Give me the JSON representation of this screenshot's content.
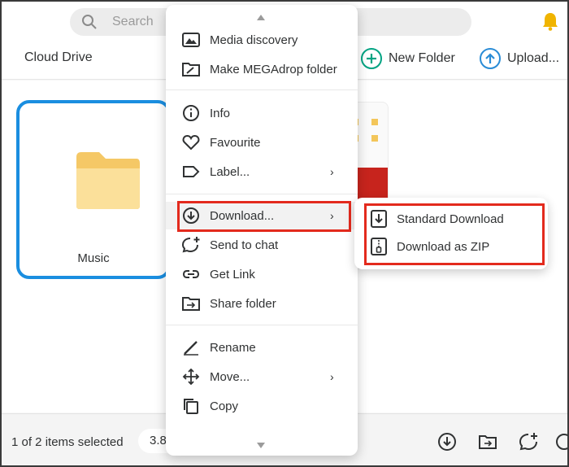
{
  "topbar": {
    "search_placeholder": "Search",
    "breadcrumb": "Cloud Drive",
    "new_folder_label": "New Folder",
    "upload_label": "Upload...",
    "accent_green": "#00a382",
    "accent_blue": "#2a8cd6",
    "bell_color": "#f0b400"
  },
  "main": {
    "folder_name": "Music",
    "selection_color": "#1a8ee0"
  },
  "bottombar": {
    "selection_text": "1 of 2 items selected",
    "size_text": "3.8"
  },
  "context_menu": {
    "items": [
      {
        "label": "Media discovery",
        "icon": "media-discovery-icon"
      },
      {
        "label": "Make MEGAdrop folder",
        "icon": "megadrop-icon"
      },
      {
        "label": "Info",
        "icon": "info-icon"
      },
      {
        "label": "Favourite",
        "icon": "heart-icon"
      },
      {
        "label": "Label...",
        "icon": "label-icon"
      },
      {
        "label": "Download...",
        "icon": "download-icon"
      },
      {
        "label": "Send to chat",
        "icon": "send-to-chat-icon"
      },
      {
        "label": "Get Link",
        "icon": "link-icon"
      },
      {
        "label": "Share folder",
        "icon": "share-folder-icon"
      },
      {
        "label": "Rename",
        "icon": "pencil-icon"
      },
      {
        "label": "Move...",
        "icon": "move-icon"
      },
      {
        "label": "Copy",
        "icon": "copy-icon"
      }
    ],
    "highlight_color": "#e32a1d"
  },
  "submenu": {
    "items": [
      {
        "label": "Standard Download",
        "icon": "standard-download-icon"
      },
      {
        "label": "Download as ZIP",
        "icon": "zip-icon"
      }
    ]
  }
}
